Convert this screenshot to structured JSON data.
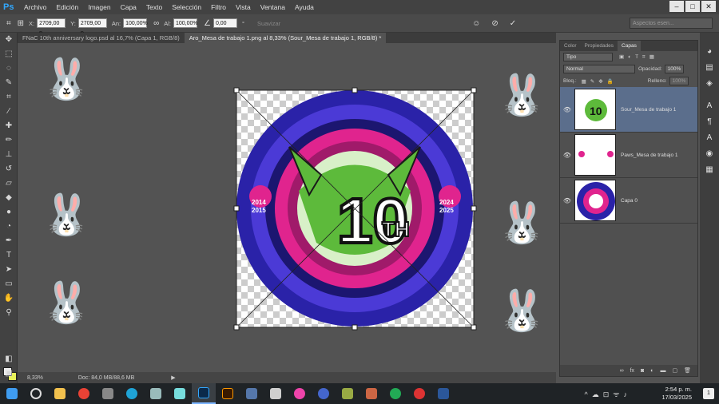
{
  "app": {
    "logo": "Ps"
  },
  "menu": [
    "Archivo",
    "Edición",
    "Imagen",
    "Capa",
    "Texto",
    "Selección",
    "Filtro",
    "Vista",
    "Ventana",
    "Ayuda"
  ],
  "window_buttons": [
    "–",
    "□",
    "✕"
  ],
  "options": {
    "x_label": "X:",
    "x_value": "2709,00 p",
    "y_label": "Y:",
    "y_value": "2709,00 p",
    "w_label": "An:",
    "w_value": "100,00%",
    "h_label": "Al:",
    "h_value": "100,00%",
    "angle_value": "0,00",
    "angle_unit": "°",
    "smooth_label": "Suavizar",
    "workspace_placeholder": "Aspectos esen..."
  },
  "doc_tabs": [
    {
      "label": "FNaC 10th anniversary logo.psd al 16,7% (Capa 1, RGB/8)",
      "active": false
    },
    {
      "label": "Aro_Mesa de trabajo 1.png al 8,33% (Sour_Mesa de trabajo 1, RGB/8) *",
      "active": true
    }
  ],
  "status": {
    "zoom": "8,33%",
    "doc": "Doc: 84,0 MB/88,6 MB"
  },
  "artwork": {
    "number": "10",
    "suffix": "TH",
    "left_years": [
      "2014",
      "2015"
    ],
    "right_years": [
      "2024",
      "2025"
    ],
    "colors": {
      "ring": "#3b2ec4",
      "pink": "#e0248e",
      "green": "#5dba3b",
      "light_green": "#d8f0c8"
    }
  },
  "panel": {
    "tabs": [
      "Color",
      "Propiedades",
      "Capas"
    ],
    "active_tab": "Capas",
    "filter_label": "Tipo",
    "blend_mode": "Normal",
    "opacity_label": "Opacidad:",
    "opacity_value": "100%",
    "lock_label": "Bloq.:",
    "fill_label": "Relleno:",
    "fill_value": "100%",
    "layers": [
      {
        "name": "Sour_Mesa de trabajo 1",
        "selected": true
      },
      {
        "name": "Paws_Mesa de trabajo 1",
        "selected": false
      },
      {
        "name": "Capa 0",
        "selected": false
      }
    ]
  },
  "taskbar": {
    "time": "2:54 p. m.",
    "date": "17/03/2025",
    "notifications": "1"
  }
}
